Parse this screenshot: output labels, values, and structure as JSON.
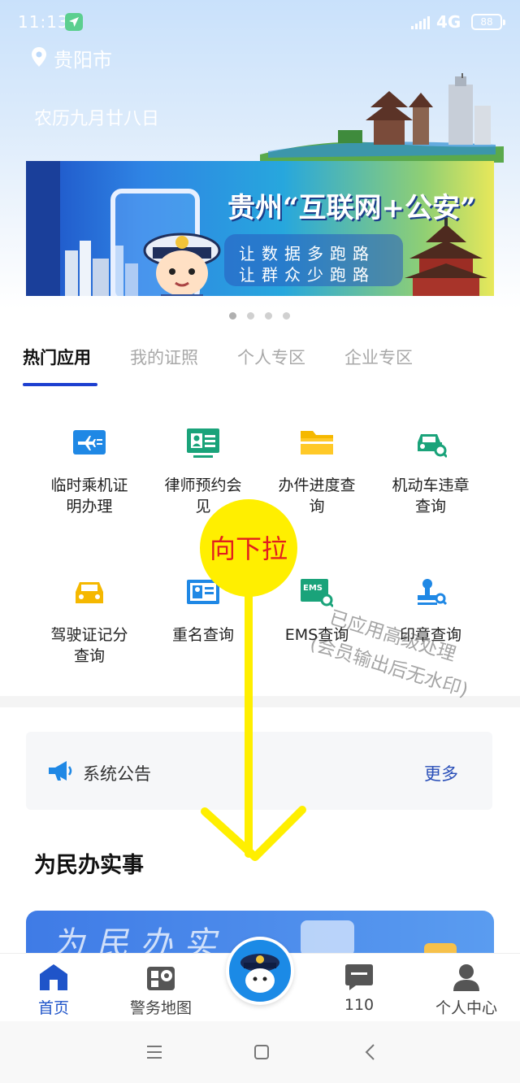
{
  "status_bar": {
    "time": "11:13",
    "network": "4G",
    "battery": "88"
  },
  "location": {
    "city": "贵阳市"
  },
  "lunar_date": "农历九月廿八日",
  "banner": {
    "title": "贵州“互联网+公安”",
    "slogan_line1": "让数据多跑路",
    "slogan_line2": "让群众少跑路",
    "page_count": 4,
    "active_page": 0
  },
  "tabs": [
    {
      "label": "热门应用",
      "active": true
    },
    {
      "label": "我的证照",
      "active": false
    },
    {
      "label": "个人专区",
      "active": false
    },
    {
      "label": "企业专区",
      "active": false
    }
  ],
  "apps": [
    {
      "label": "临时乘机证明办理",
      "icon": "plane-card-icon"
    },
    {
      "label": "律师预约会见",
      "icon": "lawyer-card-icon"
    },
    {
      "label": "办件进度查询",
      "icon": "folder-icon"
    },
    {
      "label": "机动车违章查询",
      "icon": "car-search-icon"
    },
    {
      "label": "驾驶证记分查询",
      "icon": "car-icon"
    },
    {
      "label": "重名查询",
      "icon": "id-card-icon"
    },
    {
      "label": "EMS查询",
      "icon": "ems-search-icon"
    },
    {
      "label": "印章查询",
      "icon": "stamp-search-icon"
    }
  ],
  "notice": {
    "title": "系统公告",
    "more": "更多"
  },
  "section": {
    "title": "为民办实事"
  },
  "card": {
    "text": "为民办实"
  },
  "overlay": {
    "pull_label": "向下拉"
  },
  "watermark": {
    "line1": "已应用高级处理",
    "line2": "(会员输出后无水印)"
  },
  "bottom_nav": [
    {
      "label": "首页",
      "icon": "home-icon",
      "active": true
    },
    {
      "label": "警务地图",
      "icon": "map-icon",
      "active": false
    },
    {
      "label": "110",
      "icon": "chat-icon",
      "active": false
    },
    {
      "label": "个人中心",
      "icon": "user-icon",
      "active": false
    }
  ],
  "colors": {
    "accent": "#1d3fd0",
    "icon_blue": "#1f88e5",
    "icon_green": "#1aa37a",
    "icon_yellow": "#f5b800",
    "arrow_yellow": "#ffef00"
  }
}
